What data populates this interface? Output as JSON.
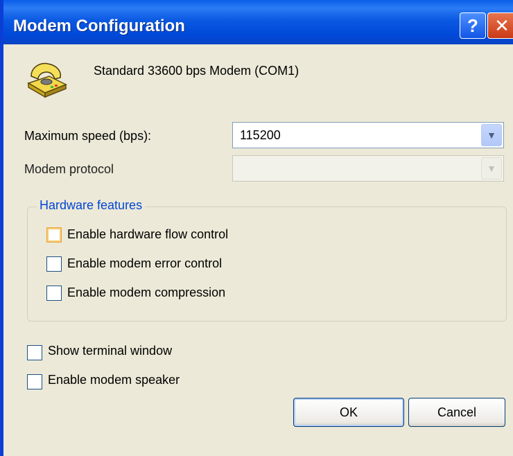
{
  "window": {
    "title": "Modem Configuration",
    "help_label": "?",
    "close_label": "✕"
  },
  "modem": {
    "icon": "telephone-modem-icon",
    "name": "Standard 33600 bps Modem (COM1)"
  },
  "max_speed": {
    "label": "Maximum speed (bps):",
    "value": "115200",
    "arrow": "▼"
  },
  "protocol": {
    "label": "Modem protocol",
    "value": "",
    "arrow": "▼",
    "enabled": false
  },
  "hardware": {
    "title": "Hardware features",
    "options": [
      {
        "label": "Enable hardware flow control",
        "checked": false,
        "focused": true
      },
      {
        "label": "Enable modem error control",
        "checked": false
      },
      {
        "label": "Enable modem compression",
        "checked": false
      }
    ]
  },
  "extra_options": [
    {
      "label": "Show terminal window",
      "checked": false
    },
    {
      "label": "Enable modem speaker",
      "checked": false
    }
  ],
  "buttons": {
    "ok": "OK",
    "cancel": "Cancel"
  },
  "colors": {
    "titlebar": "#0054e3",
    "dialog_bg": "#ece9d8",
    "group_title": "#0046d5"
  }
}
